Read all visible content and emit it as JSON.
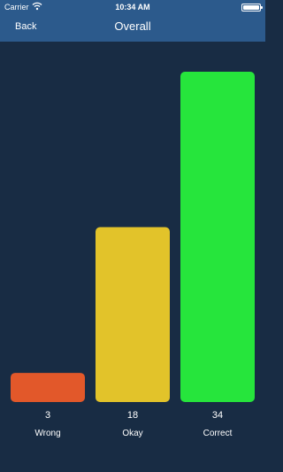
{
  "status_bar": {
    "carrier": "Carrier",
    "time": "10:34 AM"
  },
  "nav": {
    "back_label": "Back",
    "title": "Overall"
  },
  "chart_data": {
    "type": "bar",
    "categories": [
      "Wrong",
      "Okay",
      "Correct"
    ],
    "values": [
      3,
      18,
      34
    ],
    "colors": [
      "#e2582a",
      "#e2c32a",
      "#26e53c"
    ],
    "ylim": [
      0,
      34
    ],
    "grid": false,
    "title": "",
    "xlabel": "",
    "ylabel": ""
  },
  "colors": {
    "background": "#182c44",
    "bar_header": "#2c5a8c"
  }
}
